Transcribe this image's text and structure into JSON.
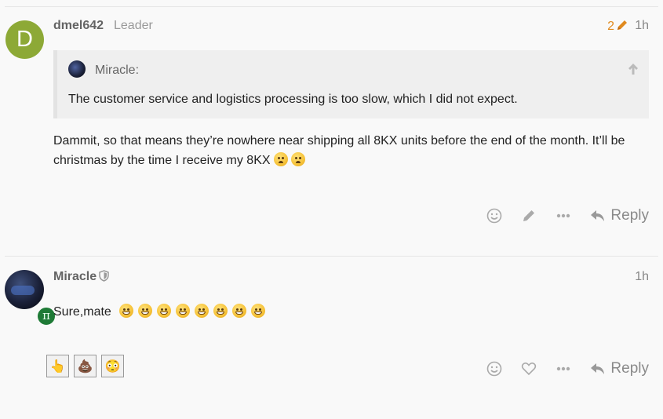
{
  "post1": {
    "avatar_letter": "D",
    "username": "dmel642",
    "user_title": "Leader",
    "edit_count": "2",
    "date": "1h",
    "quote": {
      "username": "Miracle:",
      "text": "The customer service and logistics processing is too slow, which I did not expect."
    },
    "body_line1": "Dammit, so that means they’re nowhere near shipping all 8KX units before the end of the month. It’ll be",
    "body_line2": "christmas by the time I receive my 8KX",
    "body_emojis": [
      "frowning-face",
      "frowning-face"
    ],
    "actions": [
      "smiley-icon",
      "pencil-icon",
      "ellipsis-icon"
    ],
    "reply_label": "Reply"
  },
  "post2": {
    "username": "Miracle",
    "flair": "π",
    "date": "1h",
    "body_text": "Sure,mate",
    "body_emojis": [
      "grinning-face",
      "grinning-face",
      "grinning-face",
      "grinning-face",
      "grinning-face",
      "grinning-face",
      "grinning-face",
      "grinning-face"
    ],
    "reactions": [
      "👆",
      "💩",
      "😳"
    ],
    "actions": [
      "smiley-icon",
      "heart-icon",
      "ellipsis-icon"
    ],
    "reply_label": "Reply"
  },
  "colors": {
    "avatar_green": "#8da936",
    "edit_orange": "#e08a1e",
    "muted_text": "#999999",
    "background": "#f9f9f9"
  }
}
